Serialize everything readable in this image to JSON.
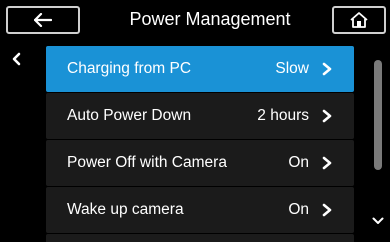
{
  "header": {
    "title": "Power Management",
    "back_icon": "back-arrow-icon",
    "home_icon": "home-icon"
  },
  "colors": {
    "accent": "#1a92d6",
    "row_bg": "#1b1b1b",
    "background": "#000000"
  },
  "items": [
    {
      "label": "Charging from PC",
      "value": "Slow",
      "selected": true
    },
    {
      "label": "Auto Power Down",
      "value": "2 hours",
      "selected": false
    },
    {
      "label": "Power Off with Camera",
      "value": "On",
      "selected": false
    },
    {
      "label": "Wake up camera",
      "value": "On",
      "selected": false
    }
  ]
}
